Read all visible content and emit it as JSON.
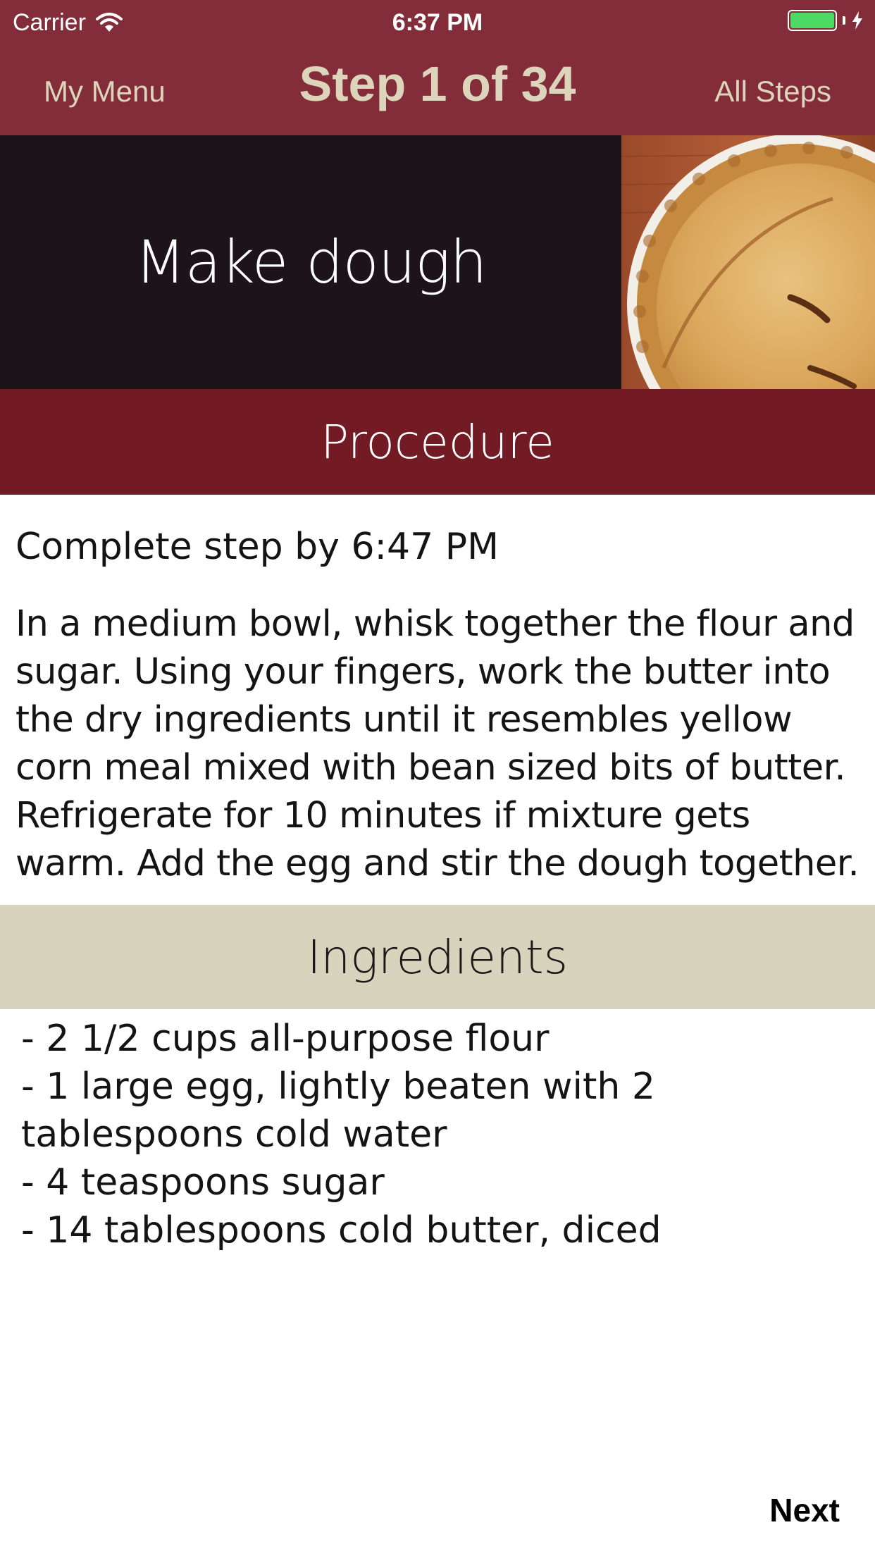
{
  "status_bar": {
    "carrier": "Carrier",
    "time": "6:37 PM",
    "battery_color": "#4cd964",
    "wifi_icon": "wifi-icon",
    "charging_icon": "bolt-icon"
  },
  "nav": {
    "left_label": "My Menu",
    "title": "Step 1 of 34",
    "right_label": "All Steps",
    "bar_color": "#832d3a",
    "text_color": "#dcd4bb"
  },
  "step": {
    "title": "Make dough",
    "image": "pie-photo"
  },
  "procedure": {
    "header": "Procedure",
    "deadline": "Complete step by 6:47 PM",
    "text": "In a medium bowl, whisk together the flour and sugar. Using your fingers, work the butter into the dry ingredients until it resembles yellow corn meal mixed with bean sized bits of butter. Refrigerate for 10 minutes if mixture gets warm. Add the egg and stir the dough together."
  },
  "ingredients": {
    "header": "Ingredients",
    "items": [
      "- 2 1/2 cups all-purpose flour",
      "- 1 large egg, lightly beaten with 2 tablespoons cold water",
      "- 4 teaspoons sugar",
      "- 14 tablespoons cold butter, diced"
    ]
  },
  "footer": {
    "next_label": "Next"
  }
}
